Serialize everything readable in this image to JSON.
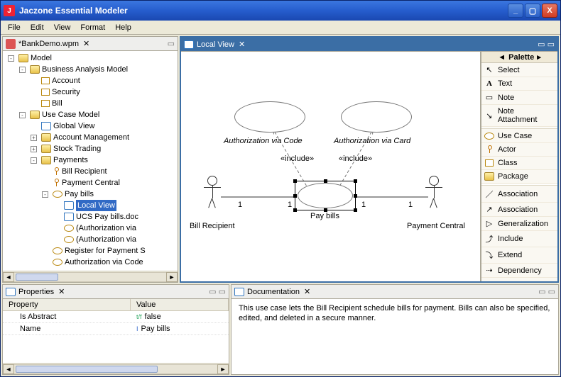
{
  "title": "Jaczone Essential Modeler",
  "menus": [
    "File",
    "Edit",
    "View",
    "Format",
    "Help"
  ],
  "editorTab": "*BankDemo.wpm",
  "tree": {
    "root": "Model",
    "bam": "Business Analysis Model",
    "bam_items": [
      "Account",
      "Security",
      "Bill"
    ],
    "ucm": "Use Case Model",
    "ucm_items": {
      "globalView": "Global View",
      "acctMgmt": "Account Management",
      "stockTrading": "Stock Trading",
      "payments": "Payments",
      "payments_children": {
        "billRecipient": "Bill Recipient",
        "paymentCentral": "Payment Central",
        "payBills": "Pay bills",
        "payBills_children": {
          "localView": "Local View",
          "ucsDoc": "UCS Pay bills.doc",
          "authA": "(Authorization via",
          "authB": "(Authorization via"
        },
        "register": "Register for Payment S",
        "authCode": "Authorization via Code"
      }
    }
  },
  "localViewTab": "Local View",
  "diagram": {
    "uc_authCode": "Authorization via Code",
    "uc_authCard": "Authorization via Card",
    "include": "«include»",
    "payBills": "Pay bills",
    "billRecipient": "Bill Recipient",
    "paymentCentral": "Payment Central",
    "one": "1"
  },
  "palette": {
    "title": "Palette",
    "select": "Select",
    "text": "Text",
    "note": "Note",
    "noteAttach": "Note Attachment",
    "usecase": "Use Case",
    "actor": "Actor",
    "class": "Class",
    "package": "Package",
    "assoc": "Association",
    "assoc2": "Association",
    "general": "Generalization",
    "include": "Include",
    "extend": "Extend",
    "dependency": "Dependency"
  },
  "propertiesTab": "Properties",
  "properties": {
    "headProp": "Property",
    "headVal": "Value",
    "rows": [
      {
        "k": "Is Abstract",
        "v": "false",
        "vicon": "bool"
      },
      {
        "k": "Name",
        "v": "Pay bills",
        "vicon": "text"
      }
    ]
  },
  "documentationTab": "Documentation",
  "documentationText": "This use case lets the Bill Recipient schedule bills for payment. Bills can also be specified, edited, and deleted in a secure manner."
}
